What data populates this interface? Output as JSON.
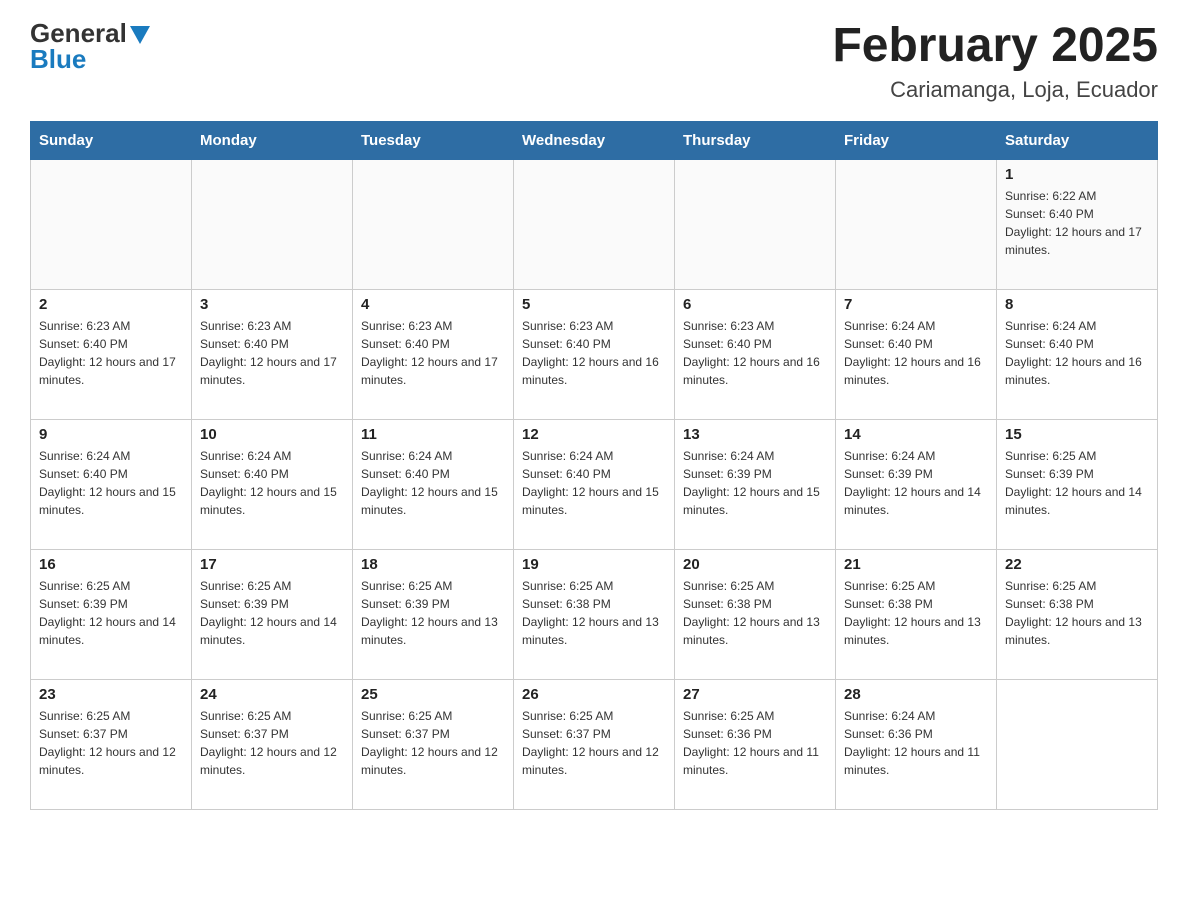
{
  "header": {
    "logo_general": "General",
    "logo_blue": "Blue",
    "month_title": "February 2025",
    "location": "Cariamanga, Loja, Ecuador"
  },
  "days_of_week": [
    "Sunday",
    "Monday",
    "Tuesday",
    "Wednesday",
    "Thursday",
    "Friday",
    "Saturday"
  ],
  "weeks": [
    [
      {
        "day": "",
        "info": ""
      },
      {
        "day": "",
        "info": ""
      },
      {
        "day": "",
        "info": ""
      },
      {
        "day": "",
        "info": ""
      },
      {
        "day": "",
        "info": ""
      },
      {
        "day": "",
        "info": ""
      },
      {
        "day": "1",
        "info": "Sunrise: 6:22 AM\nSunset: 6:40 PM\nDaylight: 12 hours and 17 minutes."
      }
    ],
    [
      {
        "day": "2",
        "info": "Sunrise: 6:23 AM\nSunset: 6:40 PM\nDaylight: 12 hours and 17 minutes."
      },
      {
        "day": "3",
        "info": "Sunrise: 6:23 AM\nSunset: 6:40 PM\nDaylight: 12 hours and 17 minutes."
      },
      {
        "day": "4",
        "info": "Sunrise: 6:23 AM\nSunset: 6:40 PM\nDaylight: 12 hours and 17 minutes."
      },
      {
        "day": "5",
        "info": "Sunrise: 6:23 AM\nSunset: 6:40 PM\nDaylight: 12 hours and 16 minutes."
      },
      {
        "day": "6",
        "info": "Sunrise: 6:23 AM\nSunset: 6:40 PM\nDaylight: 12 hours and 16 minutes."
      },
      {
        "day": "7",
        "info": "Sunrise: 6:24 AM\nSunset: 6:40 PM\nDaylight: 12 hours and 16 minutes."
      },
      {
        "day": "8",
        "info": "Sunrise: 6:24 AM\nSunset: 6:40 PM\nDaylight: 12 hours and 16 minutes."
      }
    ],
    [
      {
        "day": "9",
        "info": "Sunrise: 6:24 AM\nSunset: 6:40 PM\nDaylight: 12 hours and 15 minutes."
      },
      {
        "day": "10",
        "info": "Sunrise: 6:24 AM\nSunset: 6:40 PM\nDaylight: 12 hours and 15 minutes."
      },
      {
        "day": "11",
        "info": "Sunrise: 6:24 AM\nSunset: 6:40 PM\nDaylight: 12 hours and 15 minutes."
      },
      {
        "day": "12",
        "info": "Sunrise: 6:24 AM\nSunset: 6:40 PM\nDaylight: 12 hours and 15 minutes."
      },
      {
        "day": "13",
        "info": "Sunrise: 6:24 AM\nSunset: 6:39 PM\nDaylight: 12 hours and 15 minutes."
      },
      {
        "day": "14",
        "info": "Sunrise: 6:24 AM\nSunset: 6:39 PM\nDaylight: 12 hours and 14 minutes."
      },
      {
        "day": "15",
        "info": "Sunrise: 6:25 AM\nSunset: 6:39 PM\nDaylight: 12 hours and 14 minutes."
      }
    ],
    [
      {
        "day": "16",
        "info": "Sunrise: 6:25 AM\nSunset: 6:39 PM\nDaylight: 12 hours and 14 minutes."
      },
      {
        "day": "17",
        "info": "Sunrise: 6:25 AM\nSunset: 6:39 PM\nDaylight: 12 hours and 14 minutes."
      },
      {
        "day": "18",
        "info": "Sunrise: 6:25 AM\nSunset: 6:39 PM\nDaylight: 12 hours and 13 minutes."
      },
      {
        "day": "19",
        "info": "Sunrise: 6:25 AM\nSunset: 6:38 PM\nDaylight: 12 hours and 13 minutes."
      },
      {
        "day": "20",
        "info": "Sunrise: 6:25 AM\nSunset: 6:38 PM\nDaylight: 12 hours and 13 minutes."
      },
      {
        "day": "21",
        "info": "Sunrise: 6:25 AM\nSunset: 6:38 PM\nDaylight: 12 hours and 13 minutes."
      },
      {
        "day": "22",
        "info": "Sunrise: 6:25 AM\nSunset: 6:38 PM\nDaylight: 12 hours and 13 minutes."
      }
    ],
    [
      {
        "day": "23",
        "info": "Sunrise: 6:25 AM\nSunset: 6:37 PM\nDaylight: 12 hours and 12 minutes."
      },
      {
        "day": "24",
        "info": "Sunrise: 6:25 AM\nSunset: 6:37 PM\nDaylight: 12 hours and 12 minutes."
      },
      {
        "day": "25",
        "info": "Sunrise: 6:25 AM\nSunset: 6:37 PM\nDaylight: 12 hours and 12 minutes."
      },
      {
        "day": "26",
        "info": "Sunrise: 6:25 AM\nSunset: 6:37 PM\nDaylight: 12 hours and 12 minutes."
      },
      {
        "day": "27",
        "info": "Sunrise: 6:25 AM\nSunset: 6:36 PM\nDaylight: 12 hours and 11 minutes."
      },
      {
        "day": "28",
        "info": "Sunrise: 6:24 AM\nSunset: 6:36 PM\nDaylight: 12 hours and 11 minutes."
      },
      {
        "day": "",
        "info": ""
      }
    ]
  ]
}
